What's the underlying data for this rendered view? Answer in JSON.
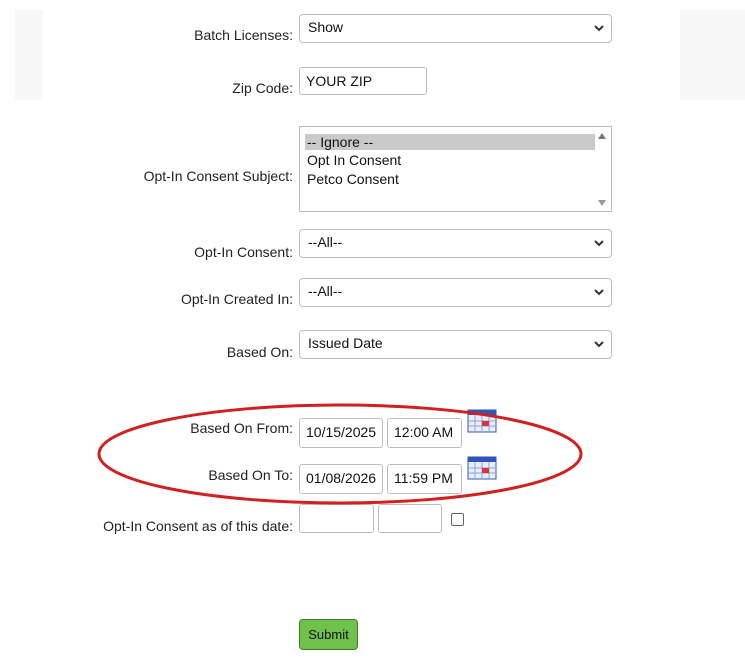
{
  "form": {
    "batch_licenses": {
      "label": "Batch Licenses:",
      "value": "Show"
    },
    "zip_code": {
      "label": "Zip Code:",
      "value": "YOUR ZIP"
    },
    "opt_in_consent_subject": {
      "label": "Opt-In Consent Subject:",
      "options": [
        "-- Ignore --",
        "Opt In Consent",
        "Petco Consent"
      ],
      "selected_index": 0
    },
    "opt_in_consent": {
      "label": "Opt-In Consent:",
      "value": "--All--"
    },
    "opt_in_created_in": {
      "label": "Opt-In Created In:",
      "value": "--All--"
    },
    "based_on": {
      "label": "Based On:",
      "value": "Issued Date"
    },
    "based_on_from": {
      "label": "Based On From:",
      "date": "10/15/2025",
      "time": "12:00 AM"
    },
    "based_on_to": {
      "label": "Based On To:",
      "date": "01/08/2026",
      "time": "11:59 PM"
    },
    "opt_in_consent_as_of": {
      "label": "Opt-In Consent as of this date:",
      "date": "",
      "time": "",
      "checked": false
    },
    "submit_label": "Submit"
  },
  "annotation": {
    "color": "#d21f1f"
  },
  "icons": {
    "calendar": "calendar-icon",
    "dropdown": "chevron-down-icon"
  }
}
